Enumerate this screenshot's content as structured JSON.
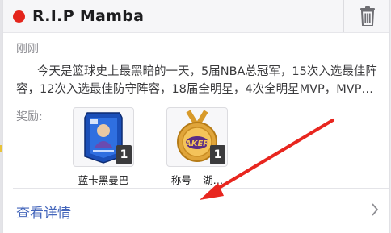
{
  "header": {
    "status_color": "#e4251c",
    "title": "R.I.P Mamba",
    "trash_icon": "trash-icon"
  },
  "post": {
    "time": "刚刚",
    "description_line1": "今天是篮球史上最黑暗的一天，5届NBA总冠军，15次入选最佳阵",
    "description_line2": "容，12次入选最佳防守阵容，18届全明星，4次全明星MVP，MVP、…"
  },
  "rewards": {
    "label": "奖励:",
    "items": [
      {
        "name": "蓝卡黑曼巴",
        "quantity": "1",
        "icon": "blue-player-card-icon"
      },
      {
        "name": "称号 – 湖…",
        "quantity": "1",
        "icon": "lakers-medal-icon"
      }
    ]
  },
  "footer": {
    "details_label": "查看详情",
    "chevron_icon": "chevron-right-icon",
    "link_color": "#4466bb"
  },
  "annotation": {
    "arrow_color": "#e8261f"
  }
}
